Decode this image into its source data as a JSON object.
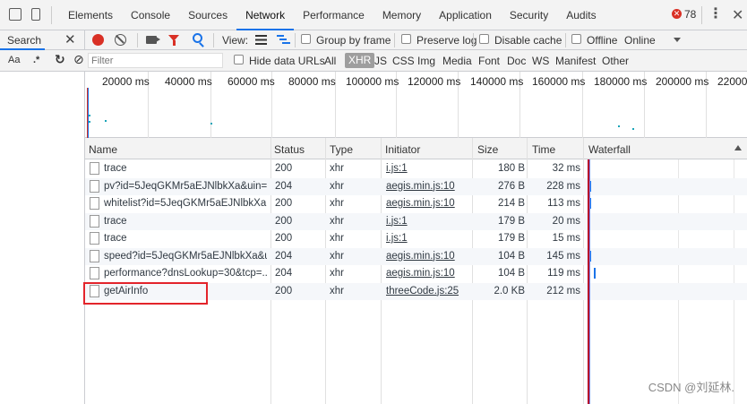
{
  "topbar": {
    "tabs": [
      "Elements",
      "Console",
      "Sources",
      "Network",
      "Performance",
      "Memory",
      "Application",
      "Security",
      "Audits"
    ],
    "active_tab": "Network",
    "error_count": "78",
    "kebab": "⋮",
    "close": "✕"
  },
  "search_panel": {
    "tab_label": "Search",
    "close": "✕",
    "match_case": "Aa",
    "regex": ".*",
    "refresh": "↻",
    "clear": "⊘"
  },
  "toolbar": {
    "view_label": "View:",
    "group_by_frame": "Group by frame",
    "preserve_log": "Preserve log",
    "disable_cache": "Disable cache",
    "offline": "Offline",
    "throttle": "Online"
  },
  "filter": {
    "placeholder": "Filter",
    "hide_data_urls": "Hide data URLs",
    "types": [
      "All",
      "XHR",
      "JS",
      "CSS",
      "Img",
      "Media",
      "Font",
      "Doc",
      "WS",
      "Manifest",
      "Other"
    ],
    "active_type": "XHR"
  },
  "overview": {
    "ticks": [
      "20000 ms",
      "40000 ms",
      "60000 ms",
      "80000 ms",
      "100000 ms",
      "120000 ms",
      "140000 ms",
      "160000 ms",
      "180000 ms",
      "200000 ms",
      "22000"
    ]
  },
  "table": {
    "headers": {
      "name": "Name",
      "status": "Status",
      "type": "Type",
      "initiator": "Initiator",
      "size": "Size",
      "time": "Time",
      "waterfall": "Waterfall"
    },
    "rows": [
      {
        "name": "trace",
        "status": "200",
        "type": "xhr",
        "initiator": "i.js:1",
        "size": "180 B",
        "time": "32 ms"
      },
      {
        "name": "pv?id=5JeqGKMr5aEJNlbkXa&uin=...",
        "status": "204",
        "type": "xhr",
        "initiator": "aegis.min.js:10",
        "size": "276 B",
        "time": "228 ms"
      },
      {
        "name": "whitelist?id=5JeqGKMr5aEJNlbkXa...",
        "status": "200",
        "type": "xhr",
        "initiator": "aegis.min.js:10",
        "size": "214 B",
        "time": "113 ms"
      },
      {
        "name": "trace",
        "status": "200",
        "type": "xhr",
        "initiator": "i.js:1",
        "size": "179 B",
        "time": "20 ms"
      },
      {
        "name": "trace",
        "status": "200",
        "type": "xhr",
        "initiator": "i.js:1",
        "size": "179 B",
        "time": "15 ms"
      },
      {
        "name": "speed?id=5JeqGKMr5aEJNlbkXa&u...",
        "status": "204",
        "type": "xhr",
        "initiator": "aegis.min.js:10",
        "size": "104 B",
        "time": "145 ms"
      },
      {
        "name": "performance?dnsLookup=30&tcp=...",
        "status": "204",
        "type": "xhr",
        "initiator": "aegis.min.js:10",
        "size": "104 B",
        "time": "119 ms"
      },
      {
        "name": "getAirInfo",
        "status": "200",
        "type": "xhr",
        "initiator": "threeCode.js:25",
        "size": "2.0 KB",
        "time": "212 ms"
      }
    ]
  },
  "watermark": "CSDN @刘延林."
}
